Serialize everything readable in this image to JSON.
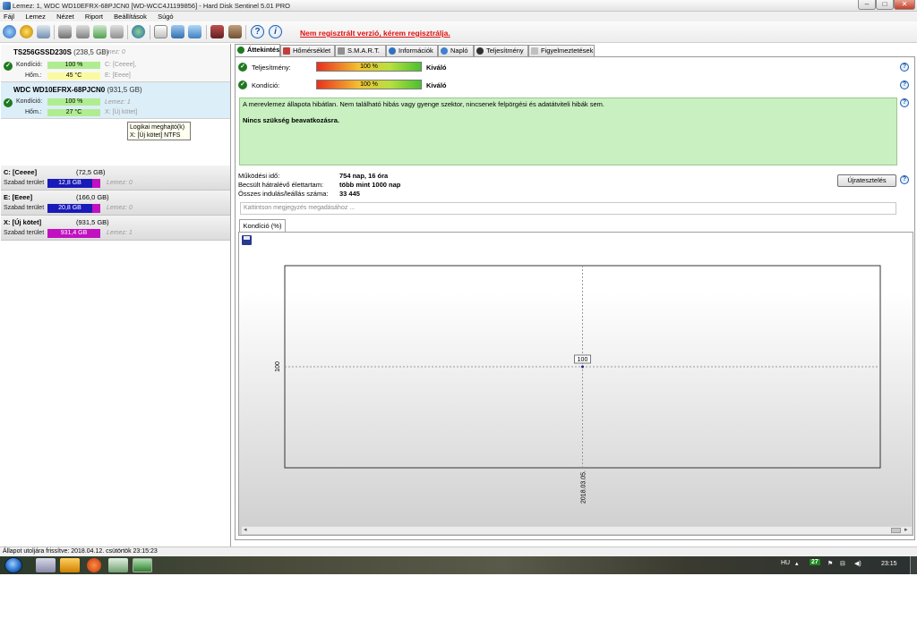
{
  "window": {
    "title": "Lemez: 1, WDC WD10EFRX-68PJCN0 [WD-WCC4J1199856]  -  Hard Disk Sentinel 5.01 PRO",
    "minimize": "–",
    "maximize": "□",
    "close": "✕"
  },
  "menu": [
    "Fájl",
    "Lemez",
    "Nézet",
    "Riport",
    "Beállítások",
    "Súgó"
  ],
  "toolbar": {
    "help_glyph": "?",
    "info_glyph": "i",
    "register_warning": "Nem regisztrált verzió, kérem regisztrálja."
  },
  "disks": [
    {
      "name": "TS256GSSD230S",
      "size": "(238,5 GB)",
      "lemez": "Lemez: 0",
      "kondicio_label": "Kondíció:",
      "kondicio": "100 %",
      "hom_label": "Hőm.:",
      "hom": "45 °C",
      "part1": "C: [Ceeee],",
      "part2": "E: [Eeee]"
    },
    {
      "name": "WDC WD10EFRX-68PJCN0",
      "size": "(931,5 GB)",
      "lemez": "Lemez: 1",
      "kondicio_label": "Kondíció:",
      "kondicio": "100 %",
      "hom_label": "Hőm.:",
      "hom": "27 °C",
      "part1": "X: [Új kötet]",
      "part2": ""
    }
  ],
  "tooltip": {
    "line1": "Logikai meghajtó(k)",
    "line2": "X: [Új kötet] NTFS"
  },
  "volumes": [
    {
      "name": "C: [Ceeee]",
      "size": "(72,5 GB)",
      "free_label": "Szabad terület",
      "free": "12,8 GB",
      "lemez": "Lemez: 0",
      "fill_color": "#1a1ab8"
    },
    {
      "name": "E: [Eeee]",
      "size": "(166,0 GB)",
      "free_label": "Szabad terület",
      "free": "20,8 GB",
      "lemez": "Lemez: 0",
      "fill_color": "#1a1ab8"
    },
    {
      "name": "X: [Új kötet]",
      "size": "(931,5 GB)",
      "free_label": "Szabad terület",
      "free": "931,4 GB",
      "lemez": "Lemez: 1",
      "fill_color": "#c010c0"
    }
  ],
  "tabs": [
    "Áttekintés",
    "Hőmérséklet",
    "S.M.A.R.T.",
    "Információk",
    "Napló",
    "Teljesítmény",
    "Figyelmeztetések"
  ],
  "overview": {
    "teljesitmeny_label": "Teljesítmény:",
    "teljesitmeny_value": "100 %",
    "teljesitmeny_rating": "Kiváló",
    "kondicio_label": "Kondíció:",
    "kondicio_value": "100 %",
    "kondicio_rating": "Kiváló",
    "message": "A merevlemez állapota hibátlan. Nem található hibás vagy gyenge szektor, nincsenek felpörgési és adatátviteli hibák sem.",
    "message_bold": "Nincs szükség beavatkozásra.",
    "uptime_label": "Működési idő:",
    "uptime_value": "754 nap, 16 óra",
    "life_label": "Becsült hátralévő élettartam:",
    "life_value": "több mint 1000 nap",
    "starts_label": "Összes indulás/leállás száma:",
    "starts_value": "33 445",
    "restart_button": "Újratesztelés",
    "note_placeholder": "Kattintson megjegyzés megadásához ..."
  },
  "chart_tab": "Kondíció  (%)",
  "chart_data": {
    "type": "line",
    "x": [
      "2018.03.05."
    ],
    "series": [
      {
        "values": [
          100
        ]
      }
    ],
    "ylabel": "100",
    "data_labels": [
      "100"
    ],
    "grid": true
  },
  "statusbar": "Állapot utoljára frissítve: 2018.04.12. csütörtök 23:15:23",
  "taskbar": {
    "lang": "HU",
    "badge": "27",
    "clock": "23:15"
  }
}
